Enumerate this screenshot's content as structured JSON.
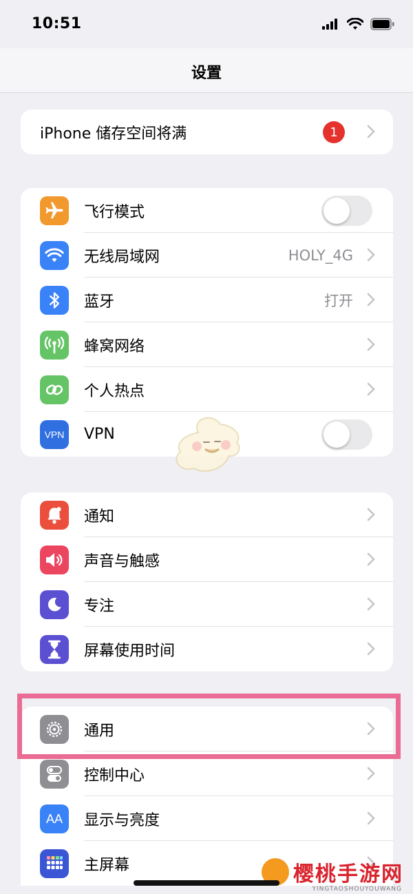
{
  "status_bar": {
    "time": "10:51"
  },
  "nav": {
    "title": "设置"
  },
  "storage_alert": {
    "label": "iPhone 储存空间将满",
    "badge": "1"
  },
  "connectivity": [
    {
      "label": "飞行模式",
      "icon": "airplane-icon",
      "color": "#f1992d",
      "control": "toggle",
      "toggle_on": false
    },
    {
      "label": "无线局域网",
      "value": "HOLY_4G",
      "icon": "wifi-icon",
      "color": "#3a82f7"
    },
    {
      "label": "蓝牙",
      "value": "打开",
      "icon": "bluetooth-icon",
      "color": "#3a82f7"
    },
    {
      "label": "蜂窝网络",
      "icon": "cellular-icon",
      "color": "#65c466"
    },
    {
      "label": "个人热点",
      "icon": "hotspot-icon",
      "color": "#65c466"
    },
    {
      "label": "VPN",
      "icon": "vpn-icon",
      "icon_text": "VPN",
      "color": "#2f6fe0",
      "control": "toggle",
      "toggle_on": false
    }
  ],
  "notifications_group": [
    {
      "label": "通知",
      "icon": "notification-bell-icon",
      "color": "#eb4e3d"
    },
    {
      "label": "声音与触感",
      "icon": "speaker-icon",
      "color": "#eb4560"
    },
    {
      "label": "专注",
      "icon": "moon-icon",
      "color": "#5b4fd2"
    },
    {
      "label": "屏幕使用时间",
      "icon": "hourglass-icon",
      "color": "#5b4fd2"
    }
  ],
  "general_group": [
    {
      "label": "通用",
      "icon": "gear-icon",
      "color": "#8e8e93"
    },
    {
      "label": "控制中心",
      "icon": "toggles-icon",
      "color": "#8e8e93"
    },
    {
      "label": "显示与亮度",
      "icon": "text-size-icon",
      "icon_text": "AA",
      "color": "#3a82f7"
    },
    {
      "label": "主屏幕",
      "icon": "home-screen-grid-icon",
      "color": "#3a56d4"
    }
  ],
  "watermark": {
    "brand": "樱桃手游网",
    "sub": "YINGTAOSHOUYOUWANG"
  },
  "colors": {
    "background": "#efeff4",
    "highlight": "#ea6b93",
    "badge": "#e5322d"
  }
}
